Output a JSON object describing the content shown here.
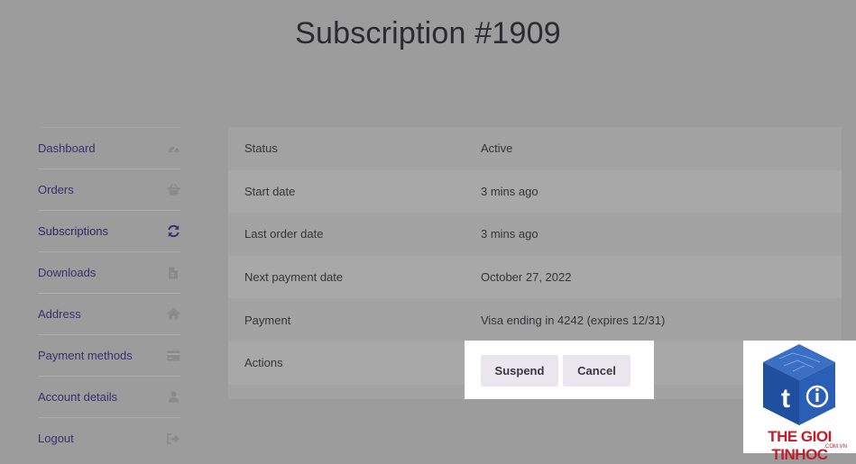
{
  "page": {
    "title": "Subscription #1909"
  },
  "sidebar": {
    "items": [
      {
        "label": "Dashboard",
        "icon": "dashboard-icon"
      },
      {
        "label": "Orders",
        "icon": "basket-icon"
      },
      {
        "label": "Subscriptions",
        "icon": "refresh-icon",
        "active": true
      },
      {
        "label": "Downloads",
        "icon": "file-icon"
      },
      {
        "label": "Address",
        "icon": "home-icon"
      },
      {
        "label": "Payment methods",
        "icon": "credit-card-icon"
      },
      {
        "label": "Account details",
        "icon": "user-icon"
      },
      {
        "label": "Logout",
        "icon": "sign-out-icon"
      }
    ]
  },
  "details": {
    "rows": [
      {
        "key": "Status",
        "value": "Active"
      },
      {
        "key": "Start date",
        "value": "3 mins ago"
      },
      {
        "key": "Last order date",
        "value": "3 mins ago"
      },
      {
        "key": "Next payment date",
        "value": "October 27, 2022"
      },
      {
        "key": "Payment",
        "value": "Visa ending in 4242 (expires 12/31)"
      },
      {
        "key": "Actions",
        "value": ""
      }
    ],
    "actions": {
      "suspend_label": "Suspend",
      "cancel_label": "Cancel"
    }
  },
  "watermark": {
    "brand": "THE GIOI TINHOC",
    "domain": ".COM.VN"
  }
}
